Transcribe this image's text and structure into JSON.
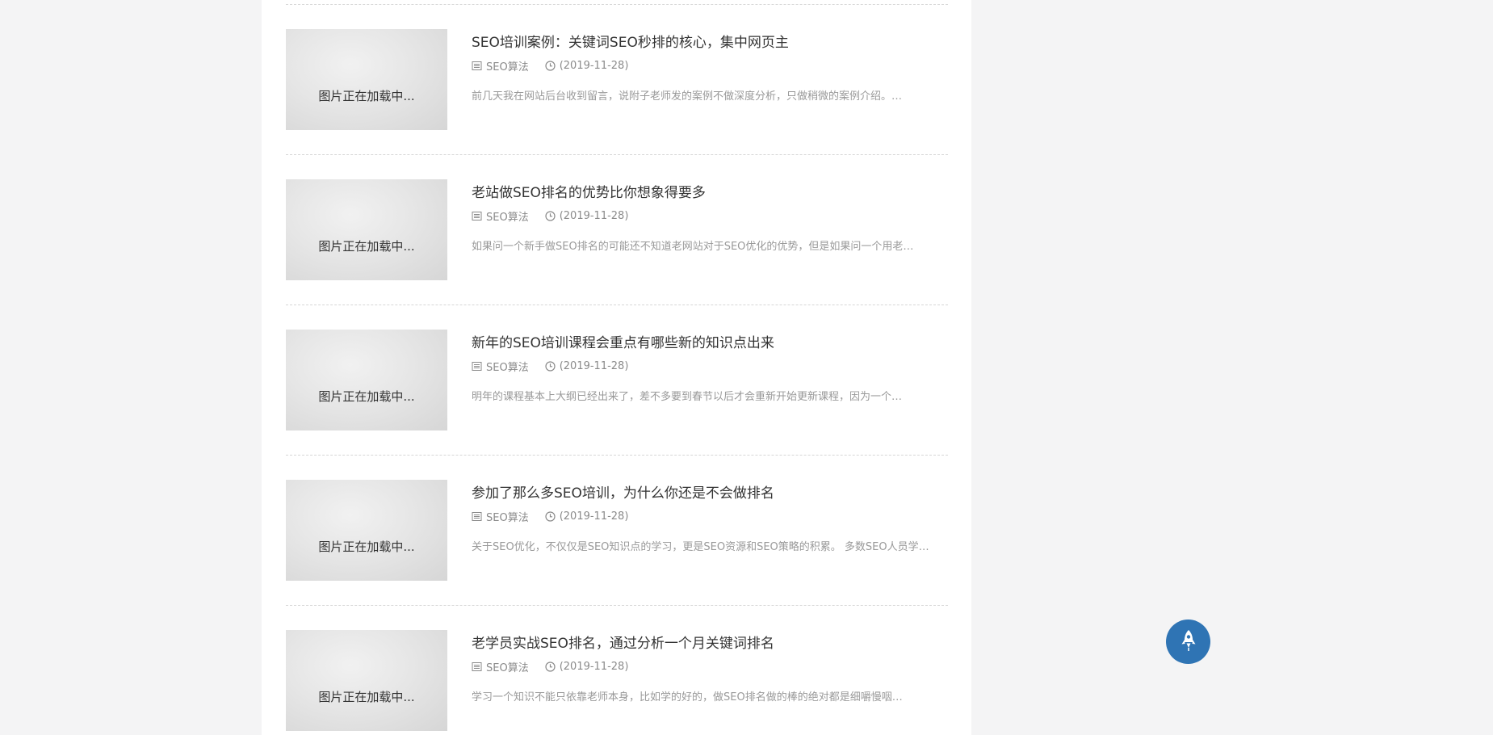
{
  "colors": {
    "page_background": "#f4f4f5",
    "content_background": "#ffffff",
    "title_text": "#333333",
    "meta_text": "#8a8a8a",
    "excerpt_text": "#999999",
    "rocket_button": "#2f74b4"
  },
  "icons": {
    "category": "list-icon",
    "date": "clock-icon",
    "back_to_top": "rocket-icon"
  },
  "articles": [
    {
      "thumb_text": "图片正在加载中...",
      "title": "SEO培训案例：关键词SEO秒排的核心，集中网页主",
      "category": "SEO算法",
      "date": "(2019-11-28)",
      "excerpt": "前几天我在网站后台收到留言，说附子老师发的案例不做深度分析，只做稍微的案例介绍。…"
    },
    {
      "thumb_text": "图片正在加载中...",
      "title": "老站做SEO排名的优势比你想象得要多",
      "category": "SEO算法",
      "date": "(2019-11-28)",
      "excerpt": "如果问一个新手做SEO排名的可能还不知道老网站对于SEO优化的优势，但是如果问一个用老…"
    },
    {
      "thumb_text": "图片正在加载中...",
      "title": "新年的SEO培训课程会重点有哪些新的知识点出来",
      "category": "SEO算法",
      "date": "(2019-11-28)",
      "excerpt": "明年的课程基本上大纲已经出来了，差不多要到春节以后才会重新开始更新课程，因为一个…"
    },
    {
      "thumb_text": "图片正在加载中...",
      "title": "参加了那么多SEO培训，为什么你还是不会做排名",
      "category": "SEO算法",
      "date": "(2019-11-28)",
      "excerpt": "关于SEO优化，不仅仅是SEO知识点的学习，更是SEO资源和SEO策略的积累。 多数SEO人员学…"
    },
    {
      "thumb_text": "图片正在加载中...",
      "title": "老学员实战SEO排名，通过分析一个月关键词排名",
      "category": "SEO算法",
      "date": "(2019-11-28)",
      "excerpt": "学习一个知识不能只依靠老师本身，比如学的好的，做SEO排名做的棒的绝对都是细嚼慢咽…"
    }
  ]
}
